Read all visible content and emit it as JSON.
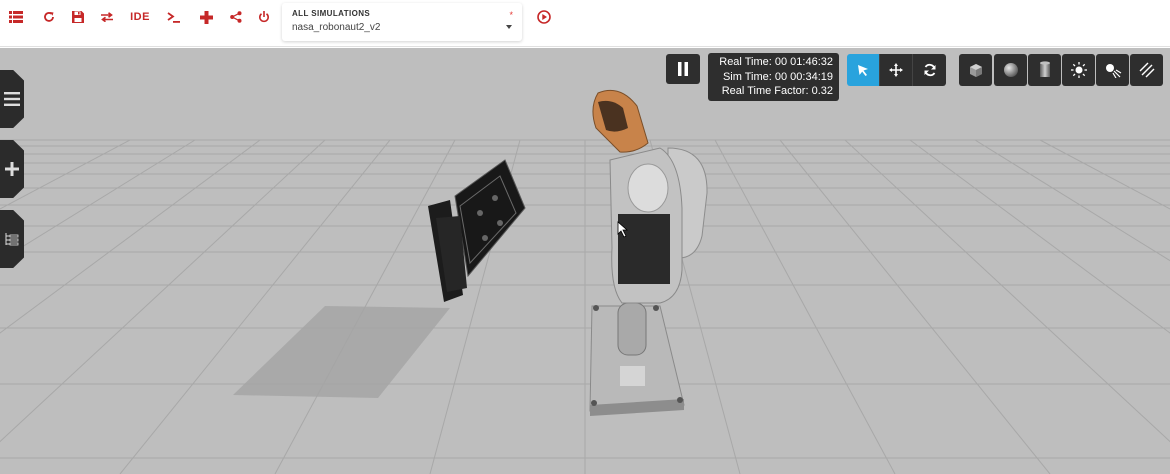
{
  "toolbar": {
    "ide_label": "IDE",
    "accent_color": "#c62828"
  },
  "simulation_select": {
    "label": "ALL SIMULATIONS",
    "value": "nasa_robonaut2_v2",
    "modified_marker": "*"
  },
  "time_display": {
    "real_time": "Real Time: 00 01:46:32",
    "sim_time": "Sim Time: 00 00:34:19",
    "real_time_factor": "Real Time Factor: 0.32"
  },
  "icons": {
    "toolbar": [
      "list-icon",
      "refresh-icon",
      "save-icon",
      "swap-icon",
      "terminal-icon",
      "plugin-icon",
      "share-icon",
      "power-icon",
      "record-icon"
    ],
    "side_tabs": [
      "hamburger-icon",
      "plus-icon",
      "tree-icon"
    ],
    "manipulation": [
      "select-arrow-icon",
      "translate-icon",
      "rotate-icon"
    ],
    "shapes": [
      "box-icon",
      "sphere-icon",
      "cylinder-icon",
      "sun-light-icon",
      "spot-light-icon",
      "directional-light-icon"
    ]
  },
  "colors": {
    "active_tool": "#29a3dd",
    "panel_bg": "#2e2e2e",
    "ground": "#bebebe"
  }
}
